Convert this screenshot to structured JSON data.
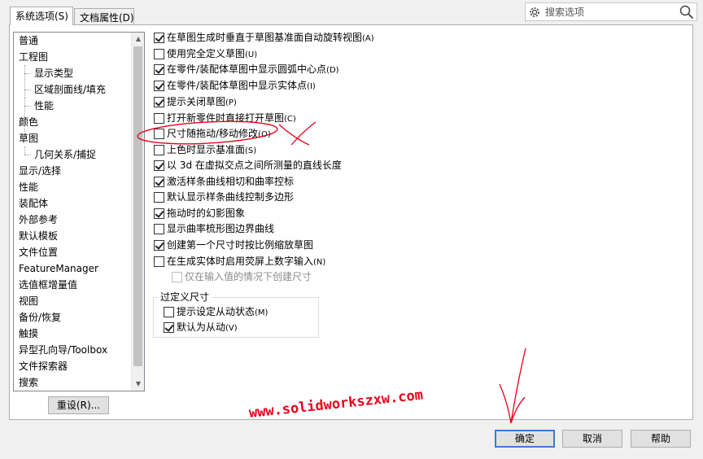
{
  "tabs": [
    {
      "label": "系统选项(S)"
    },
    {
      "label": "文档属性(D)"
    }
  ],
  "search": {
    "placeholder": "搜索选项"
  },
  "tree": {
    "items": [
      {
        "label": "普通",
        "level": 0
      },
      {
        "label": "工程图",
        "level": 0
      },
      {
        "label": "显示类型",
        "level": 1
      },
      {
        "label": "区域剖面线/填充",
        "level": 1
      },
      {
        "label": "性能",
        "level": 1
      },
      {
        "label": "颜色",
        "level": 0
      },
      {
        "label": "草图",
        "level": 0
      },
      {
        "label": "几何关系/捕捉",
        "level": 1
      },
      {
        "label": "显示/选择",
        "level": 0
      },
      {
        "label": "性能",
        "level": 0
      },
      {
        "label": "装配体",
        "level": 0
      },
      {
        "label": "外部参考",
        "level": 0
      },
      {
        "label": "默认模板",
        "level": 0
      },
      {
        "label": "文件位置",
        "level": 0
      },
      {
        "label": "FeatureManager",
        "level": 0
      },
      {
        "label": "选值框增量值",
        "level": 0
      },
      {
        "label": "视图",
        "level": 0
      },
      {
        "label": "备份/恢复",
        "level": 0
      },
      {
        "label": "触摸",
        "level": 0
      },
      {
        "label": "异型孔向导/Toolbox",
        "level": 0
      },
      {
        "label": "文件探索器",
        "level": 0
      },
      {
        "label": "搜索",
        "level": 0
      }
    ]
  },
  "reset_button": {
    "label": "重设(R)..."
  },
  "options": [
    {
      "label": "在草图生成时垂直于草图基准面自动旋转视图",
      "hotkey": "(A)",
      "checked": true
    },
    {
      "label": "使用完全定义草图",
      "hotkey": "(U)",
      "checked": false
    },
    {
      "label": "在零件/装配体草图中显示圆弧中心点",
      "hotkey": "(D)",
      "checked": true
    },
    {
      "label": "在零件/装配体草图中显示实体点",
      "hotkey": "(I)",
      "checked": true
    },
    {
      "label": "提示关闭草图",
      "hotkey": "(P)",
      "checked": true
    },
    {
      "label": "打开新零件时直接打开草图",
      "hotkey": "(C)",
      "checked": false
    },
    {
      "label": "尺寸随拖动/移动修改",
      "hotkey": "(O)",
      "checked": false
    },
    {
      "label": "上色时显示基准面",
      "hotkey": "(S)",
      "checked": false
    },
    {
      "label": "以 3d 在虚拟交点之间所测量的直线长度",
      "hotkey": "",
      "checked": true
    },
    {
      "label": "激活样条曲线相切和曲率控标",
      "hotkey": "",
      "checked": true
    },
    {
      "label": "默认显示样条曲线控制多边形",
      "hotkey": "",
      "checked": false
    },
    {
      "label": "拖动时的幻影图象",
      "hotkey": "",
      "checked": true
    },
    {
      "label": "显示曲率梳形图边界曲线",
      "hotkey": "",
      "checked": false
    },
    {
      "label": "创建第一个尺寸时按比例缩放草图",
      "hotkey": "",
      "checked": true
    },
    {
      "label": "在生成实体时启用荧屏上数字输入",
      "hotkey": "(N)",
      "checked": false
    },
    {
      "label": "仅在输入值的情况下创建尺寸",
      "hotkey": "",
      "checked": false,
      "disabled": true
    }
  ],
  "overdefine": {
    "title": "过定义尺寸",
    "items": [
      {
        "label": "提示设定从动状态",
        "hotkey": "(M)",
        "checked": false
      },
      {
        "label": "默认为从动",
        "hotkey": "(V)",
        "checked": true
      }
    ]
  },
  "buttons": {
    "ok": "确定",
    "cancel": "取消",
    "help": "帮助"
  },
  "annotation": {
    "watermark": "www.solidworkszxw.com",
    "color": "#e8001a"
  }
}
